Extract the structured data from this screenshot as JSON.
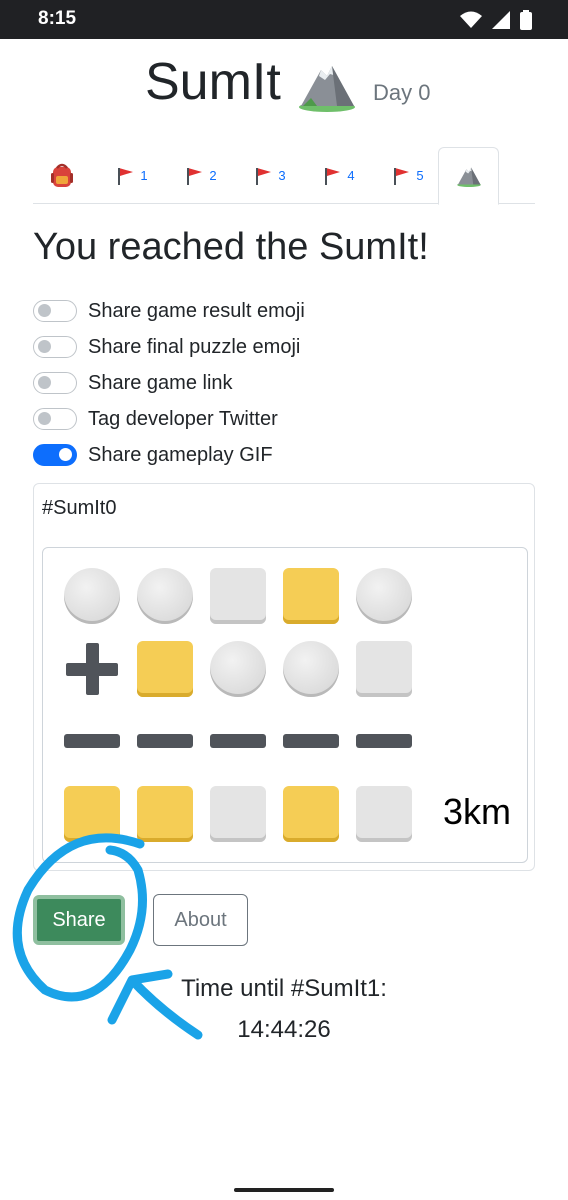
{
  "status_bar": {
    "time": "8:15"
  },
  "header": {
    "title": "SumIt",
    "day": "Day 0",
    "icon": "mountain-icon"
  },
  "tabs": [
    {
      "icon": "backpack-icon",
      "label": ""
    },
    {
      "icon": "flag-icon",
      "label": "1"
    },
    {
      "icon": "flag-icon",
      "label": "2"
    },
    {
      "icon": "flag-icon",
      "label": "3"
    },
    {
      "icon": "flag-icon",
      "label": "4"
    },
    {
      "icon": "flag-icon",
      "label": "5"
    },
    {
      "icon": "mountain-icon",
      "label": "",
      "active": true
    }
  ],
  "heading": "You reached the SumIt!",
  "options": [
    {
      "label": "Share game result emoji",
      "on": false
    },
    {
      "label": "Share final puzzle emoji",
      "on": false
    },
    {
      "label": "Share game link",
      "on": false
    },
    {
      "label": "Tag developer Twitter",
      "on": false
    },
    {
      "label": "Share gameplay GIF",
      "on": true
    }
  ],
  "result": {
    "hashtag": "#SumIt0",
    "rows": [
      [
        "circle",
        "circle",
        "gray",
        "yellow",
        "circle"
      ],
      [
        "plus",
        "yellow",
        "circle",
        "circle",
        "gray"
      ],
      [
        "dash",
        "dash",
        "dash",
        "dash",
        "dash"
      ],
      [
        "yellow",
        "yellow",
        "gray",
        "yellow",
        "gray"
      ]
    ],
    "distance": "3km"
  },
  "buttons": {
    "share": "Share",
    "about": "About"
  },
  "countdown": {
    "label": "Time until #SumIt1:",
    "time": "14:44:26"
  },
  "colors": {
    "yellow": "#f5cd55",
    "gray_tile": "#e4e4e4",
    "share_green": "#3d8a5c",
    "switch_on": "#0d6efd",
    "annotation_blue": "#1aa3e8"
  }
}
